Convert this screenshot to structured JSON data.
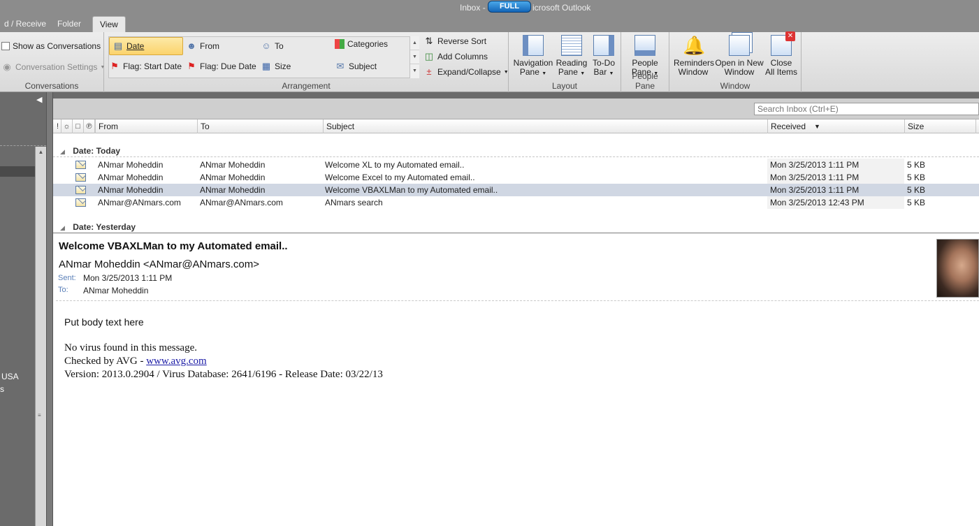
{
  "window": {
    "title_left": "Inbox -",
    "badge": "FULL",
    "title_right": "icrosoft Outlook"
  },
  "tabs": [
    {
      "label": "d / Receive"
    },
    {
      "label": "Folder"
    },
    {
      "label": "View"
    }
  ],
  "ribbon": {
    "conversations": {
      "show_as_conversations": "Show as Conversations",
      "conversation_settings": "Conversation Settings",
      "label": "Conversations"
    },
    "arrangement": {
      "date": "Date",
      "from": "From",
      "to": "To",
      "categories": "Categories",
      "flag_start": "Flag: Start Date",
      "flag_due": "Flag: Due Date",
      "size": "Size",
      "subject": "Subject",
      "reverse_sort": "Reverse Sort",
      "add_columns": "Add Columns",
      "expand_collapse": "Expand/Collapse",
      "label": "Arrangement"
    },
    "layout": {
      "navigation_pane": [
        "Navigation",
        "Pane"
      ],
      "reading_pane": [
        "Reading",
        "Pane"
      ],
      "todo_bar": [
        "To-Do",
        "Bar"
      ],
      "label": "Layout"
    },
    "people_pane": {
      "people_pane": [
        "People",
        "Pane"
      ],
      "label": "People Pane"
    },
    "window": {
      "reminders": [
        "Reminders",
        "Window"
      ],
      "open_new": [
        "Open in New",
        "Window"
      ],
      "close_all": [
        "Close",
        "All Items"
      ],
      "label": "Window"
    }
  },
  "nav": {
    "usa": "USA",
    "s": "s"
  },
  "search": {
    "placeholder": "Search Inbox (Ctrl+E)"
  },
  "columns": {
    "from": "From",
    "to": "To",
    "subject": "Subject",
    "received": "Received",
    "size": "Size"
  },
  "groups": {
    "today": "Date: Today",
    "yesterday": "Date: Yesterday"
  },
  "messages": [
    {
      "from": "ANmar Moheddin",
      "to": "ANmar Moheddin",
      "subject": "Welcome XL to my Automated email..",
      "received": "Mon 3/25/2013 1:11 PM",
      "size": "5 KB"
    },
    {
      "from": "ANmar Moheddin",
      "to": "ANmar Moheddin",
      "subject": "Welcome Excel to my Automated email..",
      "received": "Mon 3/25/2013 1:11 PM",
      "size": "5 KB"
    },
    {
      "from": "ANmar Moheddin",
      "to": "ANmar Moheddin",
      "subject": "Welcome VBAXLMan to my Automated email..",
      "received": "Mon 3/25/2013 1:11 PM",
      "size": "5 KB"
    },
    {
      "from": "ANmar@ANmars.com",
      "to": "ANmar@ANmars.com",
      "subject": "ANmars search",
      "received": "Mon 3/25/2013 12:43 PM",
      "size": "5 KB"
    }
  ],
  "reading_pane": {
    "subject": "Welcome VBAXLMan to my Automated email..",
    "from": "ANmar Moheddin <ANmar@ANmars.com>",
    "sent_label": "Sent:",
    "sent": "Mon 3/25/2013 1:11 PM",
    "to_label": "To:",
    "to": "ANmar Moheddin",
    "body_1": "Put body text here",
    "body_2": "No virus found in this message.",
    "body_3_prefix": "Checked by AVG - ",
    "body_3_link": "www.avg.com",
    "body_4": "Version: 2013.0.2904 / Virus Database: 2641/6196 - Release Date: 03/22/13"
  }
}
